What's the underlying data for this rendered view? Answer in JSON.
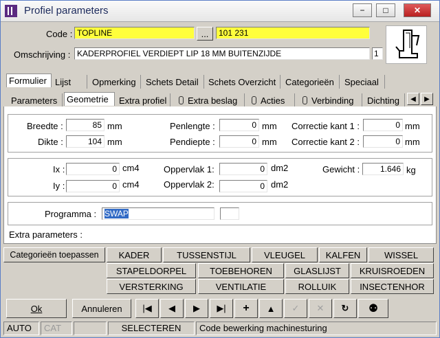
{
  "window": {
    "title": "Profiel parameters",
    "min": "−",
    "max": "□",
    "close": "✕"
  },
  "code": {
    "label": "Code :",
    "value": "TOPLINE",
    "browse": "...",
    "number": "101 231"
  },
  "desc": {
    "label": "Omschrijving :",
    "value": "KADERPROFIEL VERDIEPT LIP 18 MM BUITENZIJDE",
    "count": "1"
  },
  "tabs_main": [
    "Formulier",
    "Lijst",
    "Opmerking",
    "Schets Detail",
    "Schets Overzicht",
    "Categorieën",
    "Speciaal"
  ],
  "tabs_sub": [
    "Parameters",
    "Geometrie",
    "Extra profiel",
    "Extra beslag",
    "Acties",
    "Verbinding",
    "Dichting"
  ],
  "scroll": {
    "left": "◀",
    "right": "▶"
  },
  "dims": {
    "breedte_label": "Breedte :",
    "breedte": "85",
    "dikte_label": "Dikte :",
    "dikte": "104",
    "unit_mm": "mm",
    "penlengte_label": "Penlengte :",
    "penlengte": "0",
    "pendiepte_label": "Pendiepte :",
    "pendiepte": "0",
    "corr1_label": "Correctie kant 1 :",
    "corr1": "0",
    "corr2_label": "Correctie kant 2 :",
    "corr2": "0"
  },
  "props": {
    "ix_label": "Ix :",
    "ix": "0",
    "iy_label": "Iy :",
    "iy": "0",
    "unit_cm4": "cm4",
    "opp1_label": "Oppervlak 1:",
    "opp1": "0",
    "opp2_label": "Oppervlak 2:",
    "opp2": "0",
    "unit_dm2": "dm2",
    "gewicht_label": "Gewicht :",
    "gewicht": "1.646",
    "unit_kg": "kg"
  },
  "programma": {
    "label": "Programma :",
    "value": "SWAP",
    "extra": ""
  },
  "extra_label": "Extra parameters :",
  "categories": {
    "apply": "Categorieën toepassen",
    "row1": [
      "KADER",
      "TUSSENSTIJL",
      "VLEUGEL",
      "KALFEN",
      "WISSEL"
    ],
    "row2": [
      "STAPELDORPEL",
      "TOEBEHOREN",
      "GLASLIJST",
      "KRUISROEDEN"
    ],
    "row3": [
      "VERSTERKING",
      "VENTILATIE",
      "ROLLUIK",
      "INSECTENHOR"
    ]
  },
  "actions": {
    "ok": "Ok",
    "cancel": "Annuleren"
  },
  "nav": {
    "first": "|◀",
    "prev": "◀",
    "next": "▶",
    "last": "▶|",
    "add": "+",
    "up": "▲",
    "confirm": "✓",
    "delete": "✕",
    "refresh": "↻",
    "find": "⚉"
  },
  "status": {
    "mode": "AUTO",
    "cat": "CAT",
    "empty": "",
    "action": "SELECTEREN",
    "message": "Code bewerking machinesturing"
  }
}
